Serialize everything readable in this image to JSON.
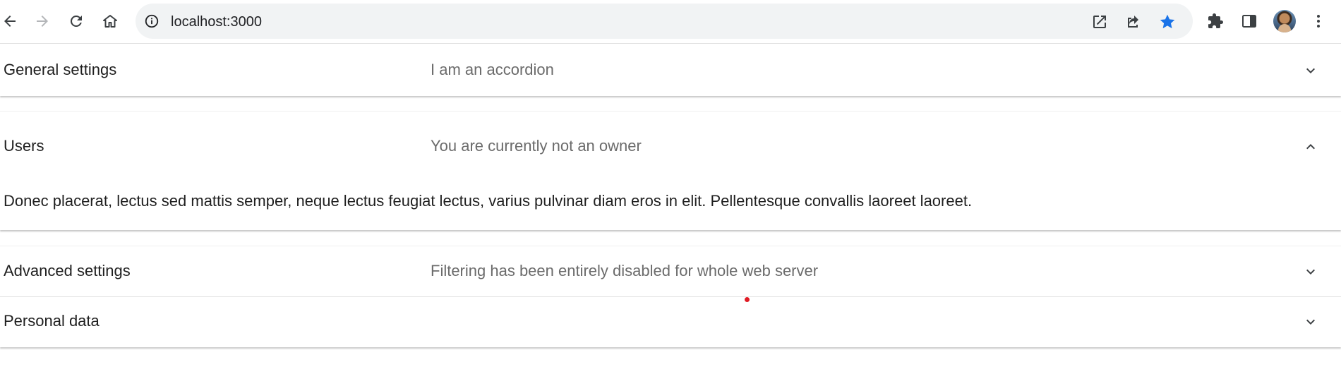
{
  "browser": {
    "url": "localhost:3000",
    "icons": {
      "back": "arrow-left-icon",
      "forward": "arrow-right-icon",
      "reload": "reload-icon",
      "home": "home-icon",
      "site_info": "info-icon",
      "open_in_new": "open-in-new-icon",
      "share": "share-icon",
      "bookmark": "star-icon",
      "extensions": "puzzle-icon",
      "side_panel": "side-panel-icon",
      "menu": "kebab-menu-icon"
    },
    "bookmark_color": "#1a73e8"
  },
  "accordion": {
    "panels": [
      {
        "title": "General settings",
        "subtitle": "I am an accordion",
        "expanded": false,
        "chevron": "chevron-down-icon"
      },
      {
        "title": "Users",
        "subtitle": "You are currently not an owner",
        "expanded": true,
        "chevron": "chevron-up-icon",
        "body": "Donec placerat, lectus sed mattis semper, neque lectus feugiat lectus, varius pulvinar diam eros in elit. Pellentesque convallis laoreet laoreet."
      },
      {
        "title": "Advanced settings",
        "subtitle": "Filtering has been entirely disabled for whole web server",
        "expanded": false,
        "chevron": "chevron-down-icon"
      },
      {
        "title": "Personal data",
        "subtitle": "",
        "expanded": false,
        "chevron": "chevron-down-icon"
      }
    ]
  }
}
